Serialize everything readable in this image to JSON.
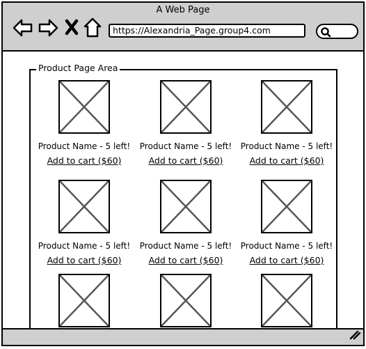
{
  "window": {
    "title": "A Web Page"
  },
  "toolbar": {
    "icons": [
      "back-arrow-icon",
      "forward-arrow-icon",
      "close-x-icon",
      "home-icon"
    ],
    "url": "https://Alexandria_Page.group4.com",
    "search_icon": "search-icon"
  },
  "area": {
    "label": "Product Page Area"
  },
  "products": [
    {
      "name": "Product Name - 5 left!",
      "cart": "Add to cart ($60)"
    },
    {
      "name": "Product Name - 5 left!",
      "cart": "Add to cart ($60)"
    },
    {
      "name": "Product Name - 5 left!",
      "cart": "Add to cart ($60)"
    },
    {
      "name": "Product Name - 5 left!",
      "cart": "Add to cart ($60)"
    },
    {
      "name": "Product Name - 5 left!",
      "cart": "Add to cart ($60)"
    },
    {
      "name": "Product Name - 5 left!",
      "cart": "Add to cart ($60)"
    },
    {
      "name": "",
      "cart": ""
    },
    {
      "name": "",
      "cart": ""
    },
    {
      "name": "",
      "cart": ""
    }
  ]
}
